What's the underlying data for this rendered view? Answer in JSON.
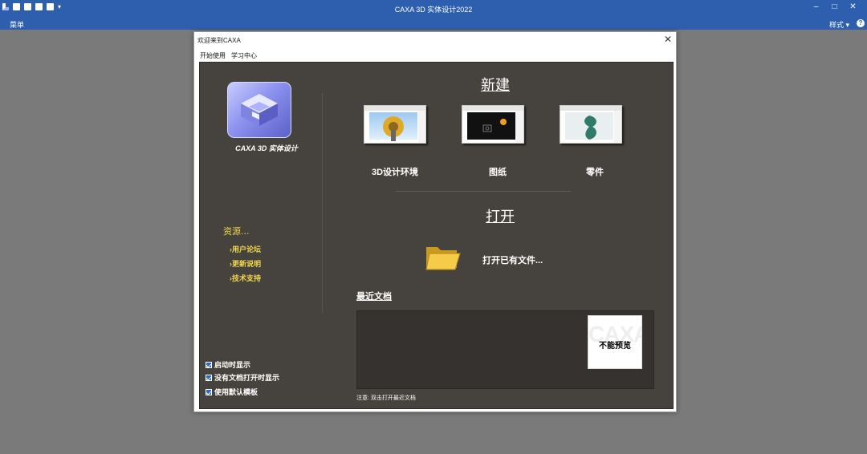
{
  "window": {
    "title": "CAXA 3D 实体设计2022",
    "minimize": "‒",
    "maximize": "□",
    "close": "✕"
  },
  "menubar": {
    "menu_label": "菜单",
    "style_label": "样式",
    "style_arrow": "▾",
    "help": "?"
  },
  "dialog": {
    "title": "欢迎来到CAXA",
    "close": "✕",
    "tabs": [
      "开始使用",
      "学习中心"
    ]
  },
  "left": {
    "logo_text": "CAXA 3D 实体设计",
    "resources_title": "资源...",
    "links": [
      "›用户论坛",
      "›更新说明",
      "›技术支持"
    ],
    "checkboxes": [
      {
        "label": "启动时显示",
        "checked": true
      },
      {
        "label": "没有文档打开时显示",
        "checked": true
      },
      {
        "label": "使用默认模板",
        "checked": true
      }
    ]
  },
  "new_section": {
    "title": "新建",
    "items": [
      "3D设计环境",
      "图纸",
      "零件"
    ]
  },
  "open_section": {
    "title": "打开",
    "open_existing": "打开已有文件..."
  },
  "recent": {
    "title": "最近文档",
    "preview_watermark": "CAXA",
    "preview_text": "不能预览",
    "note": "注意: 双击打开最近文档"
  },
  "colors": {
    "title_bar": "#2e5fae",
    "panel_bg": "#46423d",
    "link_yellow": "#f2d84a"
  }
}
